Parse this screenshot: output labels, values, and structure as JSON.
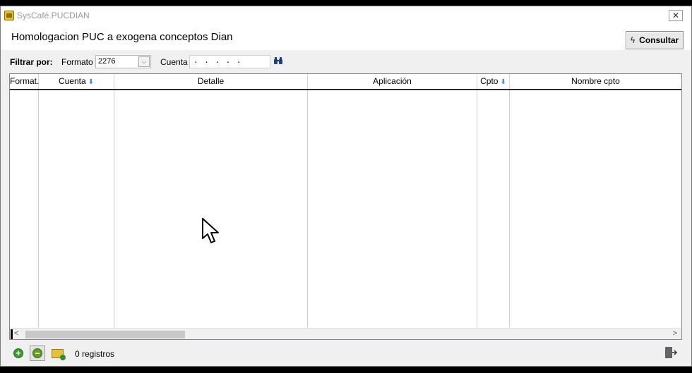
{
  "window": {
    "title": "SysCafé.PUCDIAN",
    "close_label": "✕"
  },
  "header": {
    "title": "Homologacion PUC a exogena conceptos Dian",
    "consultar_label": "Consultar"
  },
  "filter": {
    "label": "Filtrar por:",
    "formato_label": "Formato",
    "formato_value": "2276",
    "cuenta_label": "Cuenta",
    "cuenta_value": ". . . . ."
  },
  "grid": {
    "columns": [
      {
        "label": "Format.",
        "sortable": false
      },
      {
        "label": "Cuenta",
        "sortable": true
      },
      {
        "label": "Detalle",
        "sortable": false
      },
      {
        "label": "Aplicación",
        "sortable": false
      },
      {
        "label": "Cpto",
        "sortable": true
      },
      {
        "label": "Nombre cpto",
        "sortable": false
      }
    ],
    "rows": []
  },
  "footer": {
    "records": "0 registros"
  },
  "icons": {
    "app": "syscafe-app-icon",
    "consultar": "lightning-icon",
    "search": "binoculars-icon",
    "add": "add-icon",
    "remove": "remove-icon",
    "export": "export-folder-icon",
    "exit": "exit-door-icon",
    "sort": "sort-arrow-icon"
  }
}
